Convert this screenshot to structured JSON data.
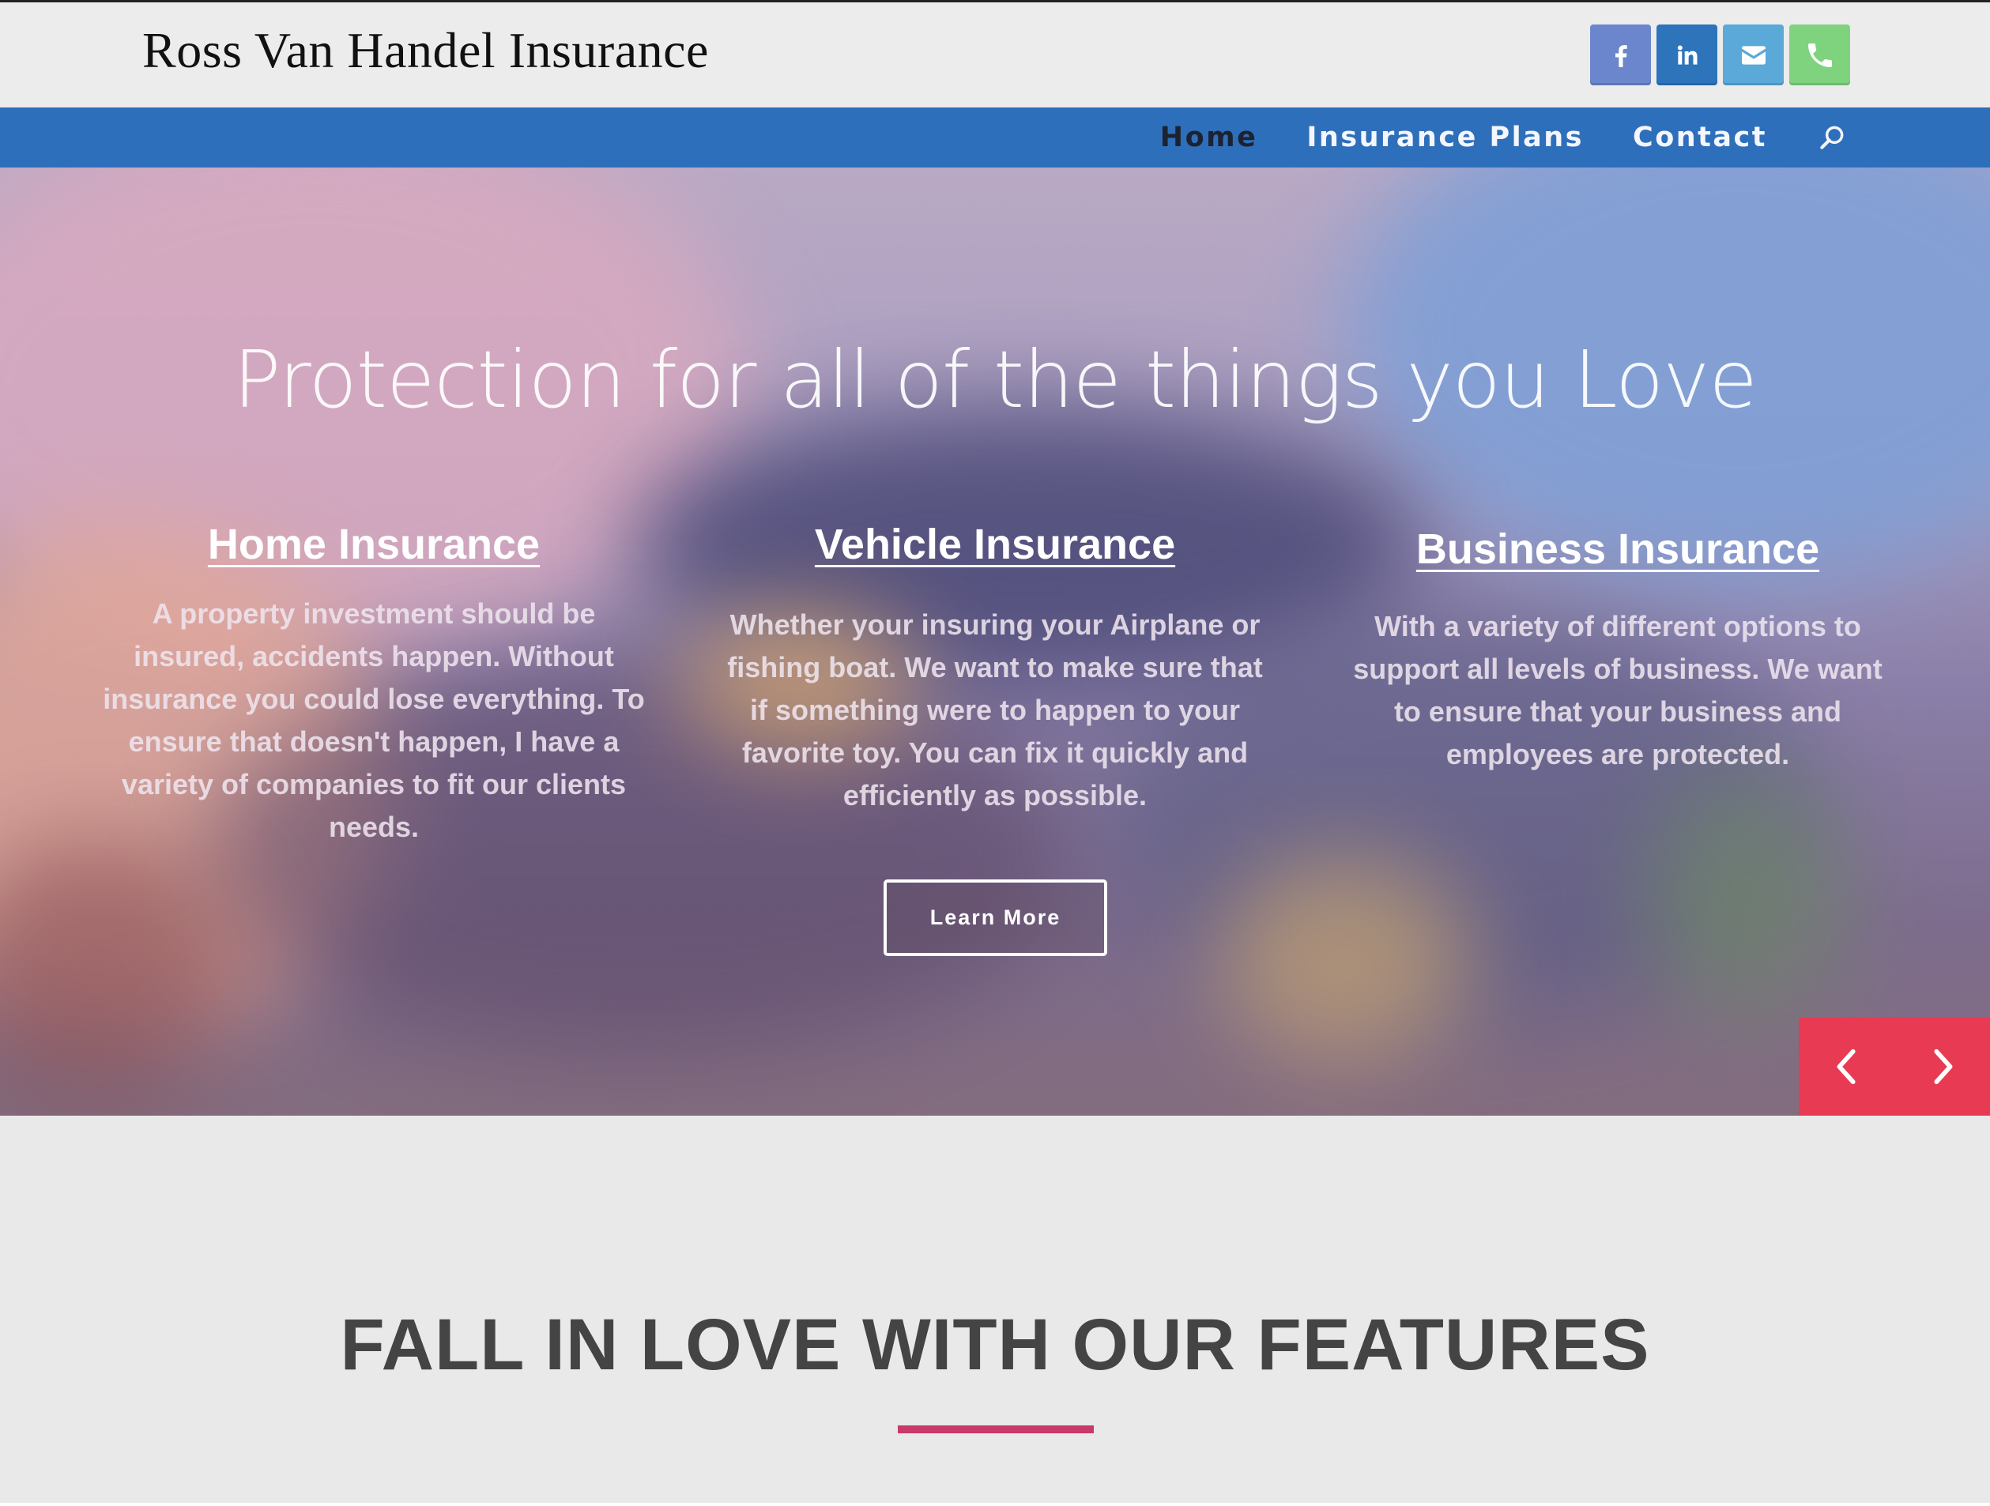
{
  "site": {
    "title": "Ross Van Handel Insurance"
  },
  "social": [
    {
      "name": "facebook-icon",
      "color": "#6b86cc"
    },
    {
      "name": "linkedin-icon",
      "color": "#2d74bb"
    },
    {
      "name": "email-icon",
      "color": "#5aa9d9"
    },
    {
      "name": "phone-icon",
      "color": "#7fd37f"
    }
  ],
  "nav": {
    "items": [
      "Home",
      "Insurance Plans",
      "Contact"
    ],
    "active": "Home",
    "search_icon": "search-icon"
  },
  "hero": {
    "title": "Protection for all of the things you Love",
    "columns": [
      {
        "heading": "Home Insurance",
        "text": "A property investment should be insured, accidents happen. Without insurance you could lose everything. To ensure that doesn't happen, I have a variety of companies to fit our clients needs."
      },
      {
        "heading": "Vehicle Insurance",
        "text": "Whether your insuring your Airplane or fishing boat. We want to make sure that if something were to happen to your favorite toy. You can fix it quickly and efficiently as possible."
      },
      {
        "heading": "Business Insurance",
        "text": "With a variety of different options to support all levels of business. We want to ensure that your business and employees are protected."
      }
    ],
    "button_label": "Learn More",
    "slider_arrows": [
      "chevron-left-icon",
      "chevron-right-icon"
    ],
    "arrow_bg": "#e83a52"
  },
  "features": {
    "title": "FALL IN LOVE WITH OUR FEATURES",
    "rule_color": "#c73a6b"
  },
  "colors": {
    "nav_bar": "#2e6fbb",
    "header_bg": "#ececec",
    "page_bg": "#e9e9e9"
  }
}
